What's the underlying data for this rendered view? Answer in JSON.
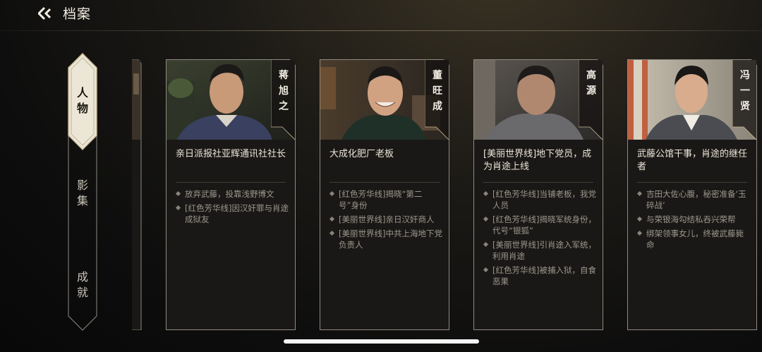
{
  "header": {
    "title": "档案"
  },
  "sidenav": {
    "tabs": [
      {
        "label": [
          "人",
          "物"
        ],
        "active": true
      },
      {
        "label": [
          "影",
          "集"
        ],
        "active": false
      },
      {
        "label": [
          "成",
          "就"
        ],
        "active": false
      }
    ]
  },
  "cards": [
    {
      "name": [
        "蒋",
        "旭",
        "之"
      ],
      "description": "亲日派报社亚辉通讯社社长",
      "facts": [
        "放弃武藤，投靠浅野博文",
        "[红色芳华线]因汉奸罪与肖途成狱友"
      ]
    },
    {
      "name": [
        "董",
        "旺",
        "成"
      ],
      "description": "大成化肥厂老板",
      "facts": [
        "[红色芳华线]揭晓“第二号”身份",
        "[美丽世界线]亲日汉奸商人",
        "[美丽世界线]中共上海地下党负责人"
      ]
    },
    {
      "name": [
        "高",
        "源"
      ],
      "description": "[美丽世界线]地下党员，成为肖途上线",
      "facts": [
        "[红色芳华线]当铺老板，我党人员",
        "[红色芳华线]揭晓军统身份，代号“银狐”",
        "[美丽世界线]引肖途入军统，利用肖途",
        "[红色芳华线]被捕入狱，自食恶果"
      ]
    },
    {
      "name": [
        "冯",
        "一",
        "贤"
      ],
      "description": "武藤公馆干事，肖途的继任者",
      "facts": [
        "吉田大佐心腹，秘密准备‘玉碎战’",
        "与荣银海勾结私吞兴荣帮",
        "绑架领事女儿，终被武藤毙命"
      ]
    }
  ],
  "colors": {
    "accent_gold": "#c8b995",
    "active_tab_bg": "#ece6d6",
    "card_bg": "#1a1816"
  }
}
